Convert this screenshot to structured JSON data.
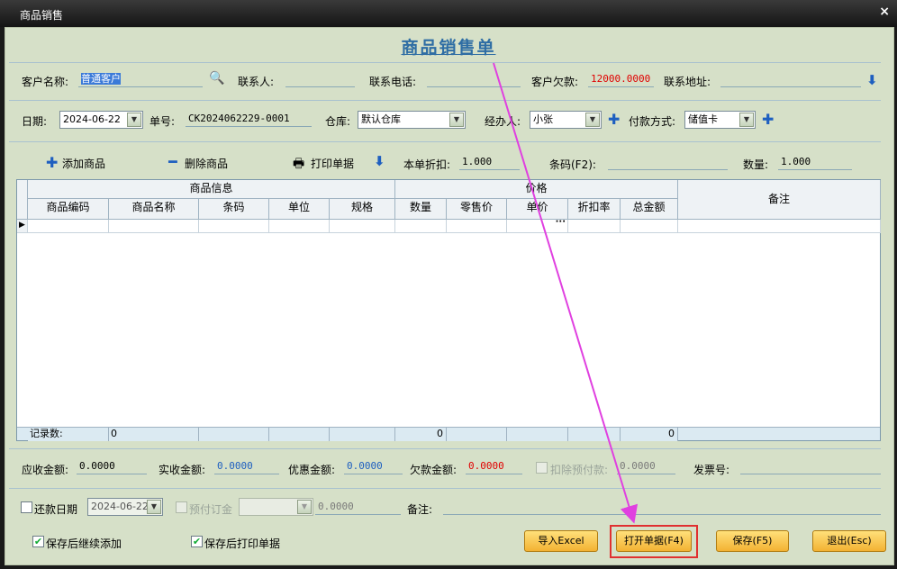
{
  "window": {
    "title": "商品销售",
    "close": "×"
  },
  "heading": "商品销售单",
  "row1": {
    "customer_label": "客户名称:",
    "customer_value": "普通客户",
    "contact_label": "联系人:",
    "phone_label": "联系电话:",
    "debt_label": "客户欠款:",
    "debt_value": "12000.0000",
    "address_label": "联系地址:"
  },
  "row2": {
    "date_label": "日期:",
    "date_value": "2024-06-22",
    "order_label": "单号:",
    "order_value": "CK2024062229-0001",
    "warehouse_label": "仓库:",
    "warehouse_value": "默认仓库",
    "handler_label": "经办人:",
    "handler_value": "小张",
    "payment_label": "付款方式:",
    "payment_value": "储值卡"
  },
  "toolbar": {
    "add": "添加商品",
    "delete": "删除商品",
    "print": "打印单据",
    "discount_label": "本单折扣:",
    "discount_value": "1.000",
    "barcode_label": "条码(F2):",
    "qty_label": "数量:",
    "qty_value": "1.000"
  },
  "grid": {
    "group_info": "商品信息",
    "group_price": "价格",
    "remark": "备注",
    "columns": [
      "商品编码",
      "商品名称",
      "条码",
      "单位",
      "规格",
      "数量",
      "零售价",
      "单价",
      "折扣率",
      "总金额"
    ],
    "footer_label": "记录数:",
    "footer_count": "0",
    "footer_qty": "0",
    "footer_amount": "0",
    "ellipsis": "···"
  },
  "totals": {
    "receivable_label": "应收金额:",
    "receivable_value": "0.0000",
    "received_label": "实收金额:",
    "received_value": "0.0000",
    "discount_label": "优惠金额:",
    "discount_value": "0.0000",
    "owed_label": "欠款金额:",
    "owed_value": "0.0000",
    "prepaid_label": "扣除预付款:",
    "prepaid_value": "0.0000",
    "invoice_label": "发票号:"
  },
  "row_repay": {
    "repay_label": "还款日期",
    "repay_date": "2024-06-22",
    "deposit_label": "预付订金",
    "deposit_value": "0.0000",
    "note_label": "备注:"
  },
  "options": {
    "continue_add": "保存后继续添加",
    "print_after": "保存后打印单据"
  },
  "buttons": {
    "import_excel": "导入Excel",
    "open": "打开单据(F4)",
    "save": "保存(F5)",
    "exit": "退出(Esc)"
  },
  "colors": {
    "panel": "#d6e0c8",
    "accent": "#2e6da4",
    "red": "#e00000",
    "annotation": "#e040e0",
    "highlight": "#e03030"
  }
}
